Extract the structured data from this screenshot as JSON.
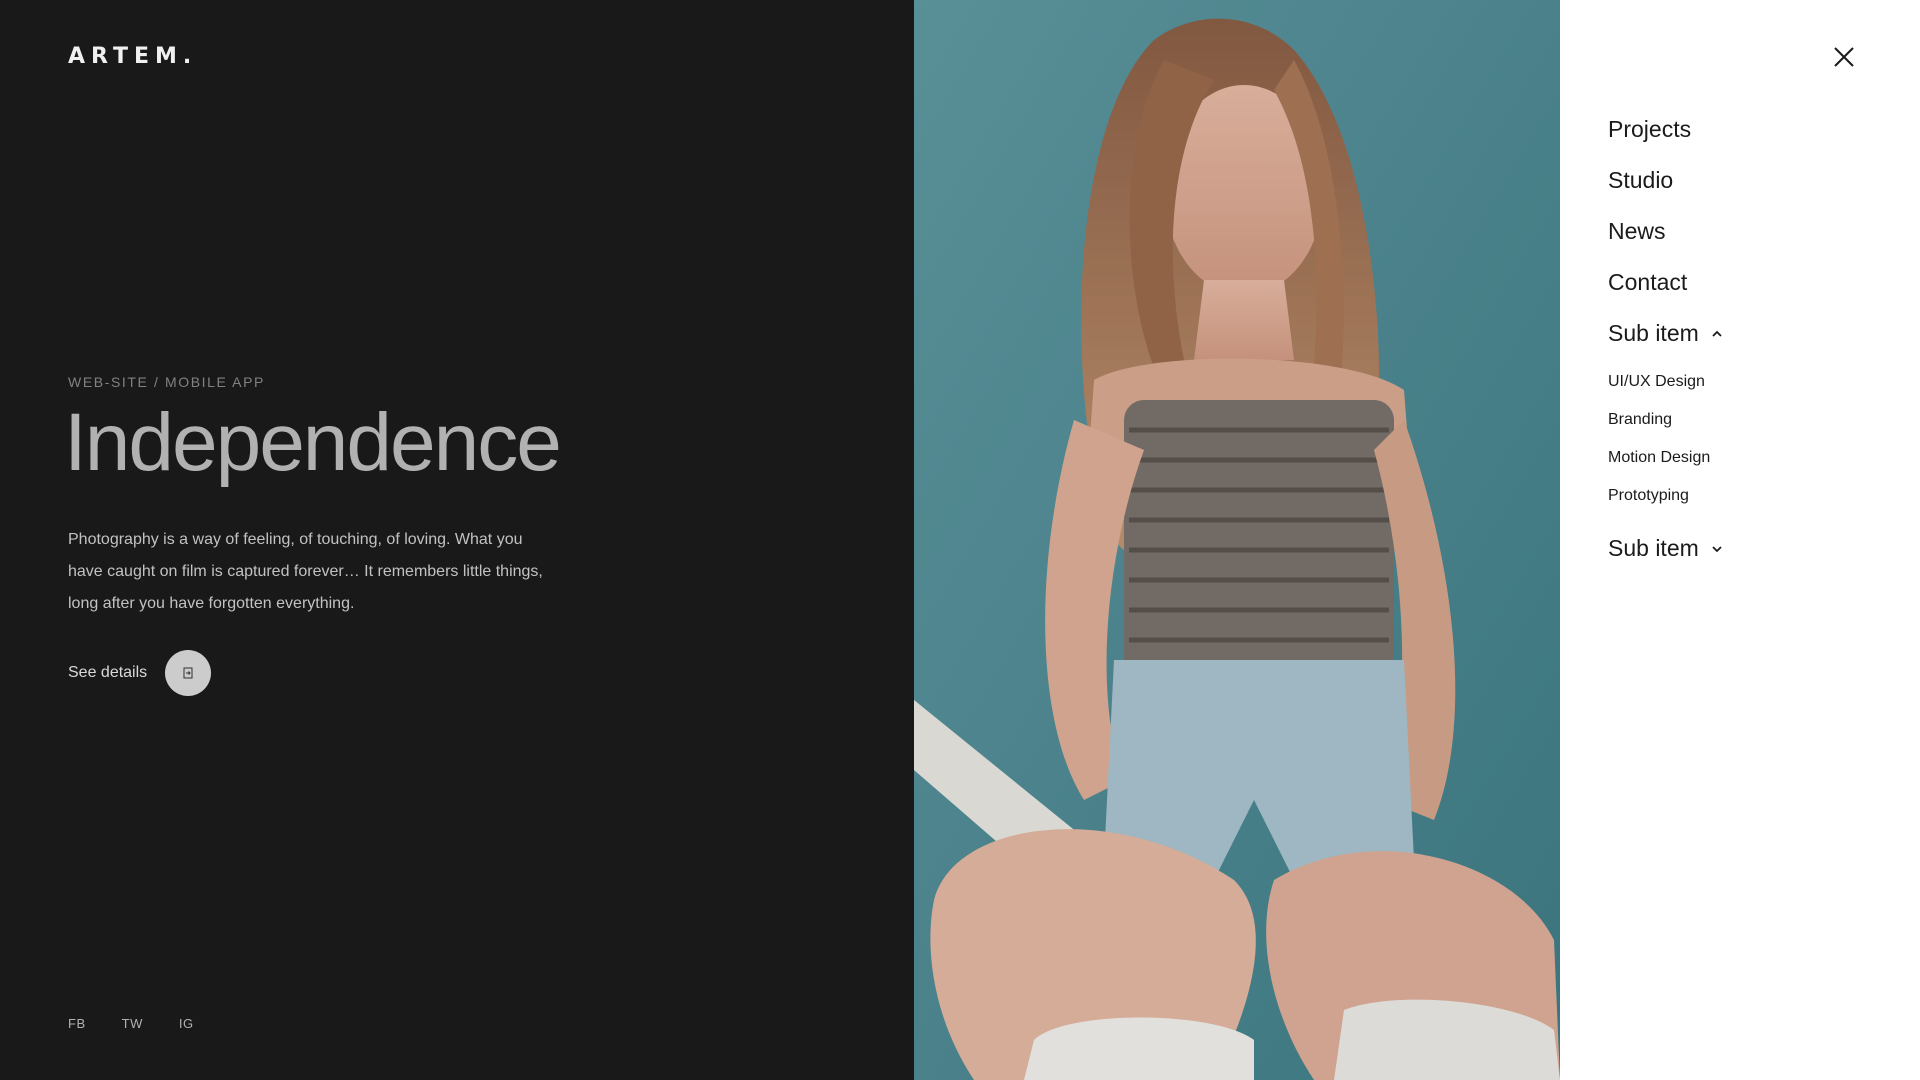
{
  "brand": {
    "logo_text": "ARTEM."
  },
  "project": {
    "category": "WEB-SITE / MOBILE APP",
    "title": "Independence",
    "description": "Photography is a way of feeling, of touching, of loving. What you have caught on film is captured forever… It remembers little things, long after you have forgotten everything.",
    "details_label": "See details"
  },
  "social": {
    "fb": "FB",
    "tw": "TW",
    "ig": "IG"
  },
  "menu": {
    "items": [
      {
        "label": "Projects"
      },
      {
        "label": "Studio"
      },
      {
        "label": "News"
      },
      {
        "label": "Contact"
      },
      {
        "label": "Sub item",
        "expanded": true
      },
      {
        "label": "Sub item",
        "expanded": false
      }
    ],
    "submenu": [
      {
        "label": "UI/UX Design"
      },
      {
        "label": "Branding"
      },
      {
        "label": "Motion Design"
      },
      {
        "label": "Prototyping"
      }
    ]
  },
  "icons": {
    "close": "close-icon",
    "arrow": "arrow-right-icon",
    "chevron_up": "chevron-up-icon",
    "chevron_down": "chevron-down-icon"
  },
  "colors": {
    "dark_bg": "#1b1b1c",
    "menu_bg": "#ffffff",
    "teal_bg": "#55909a",
    "headline": "#bdbdbd"
  }
}
